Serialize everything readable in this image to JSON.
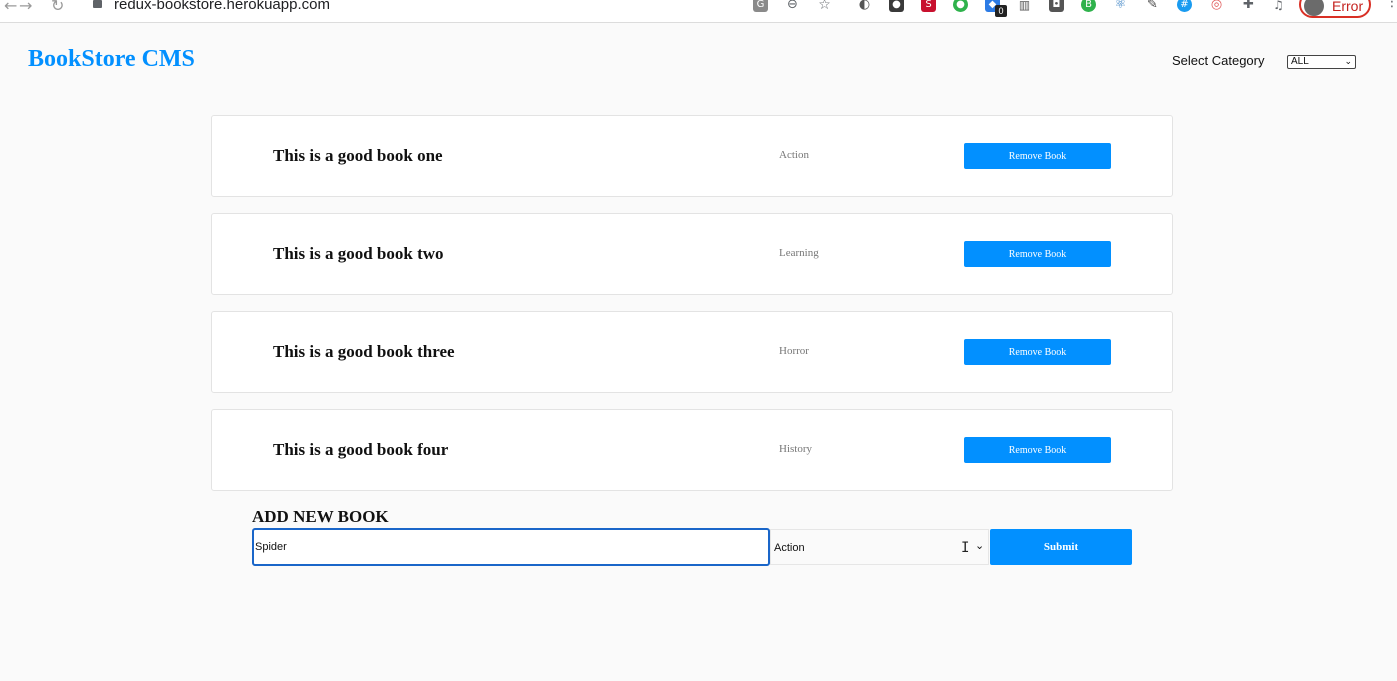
{
  "browser": {
    "url": "redux-bookstore.herokuapp.com",
    "back_glyph": "←",
    "forward_glyph": "→",
    "reload_glyph": "↻",
    "profile_status": "Error",
    "extension_badge": "0",
    "icons": [
      "translate-icon",
      "zoom-icon",
      "star-icon",
      "extension-icon",
      "extension-icon",
      "extension-icon",
      "extension-icon",
      "extension-icon",
      "extension-icon",
      "extension-icon",
      "extension-icon",
      "react-icon",
      "extension-icon",
      "extension-icon",
      "extension-icon",
      "puzzle-icon",
      "media-icon"
    ]
  },
  "header": {
    "brand": "BookStore CMS",
    "filter_label": "Select Category",
    "filter_value": "ALL"
  },
  "books": [
    {
      "title": "This is a good book one",
      "category": "Action",
      "remove_label": "Remove Book"
    },
    {
      "title": "This is a good book two",
      "category": "Learning",
      "remove_label": "Remove Book"
    },
    {
      "title": "This is a good book three",
      "category": "Horror",
      "remove_label": "Remove Book"
    },
    {
      "title": "This is a good book four",
      "category": "History",
      "remove_label": "Remove Book"
    }
  ],
  "form": {
    "heading": "ADD NEW BOOK",
    "title_value": "Spider",
    "category_value": "Action",
    "submit_label": "Submit"
  },
  "colors": {
    "accent": "#0290ff",
    "background": "#fafafa",
    "focus_border": "#1a66c9",
    "error": "#d93025"
  }
}
